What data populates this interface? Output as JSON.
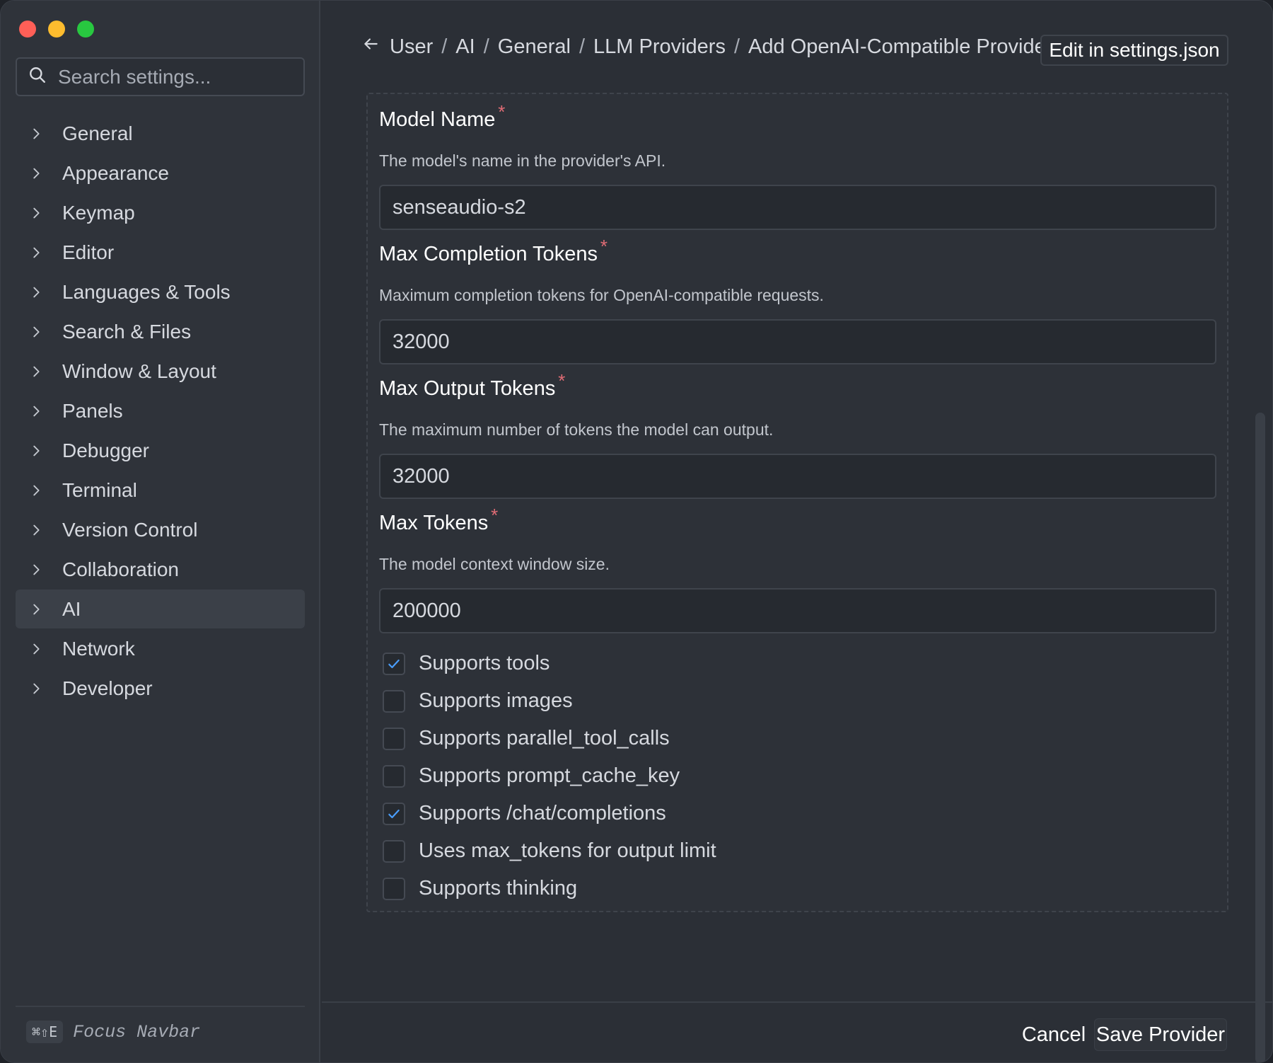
{
  "sidebar": {
    "search_placeholder": "Search settings...",
    "items": [
      {
        "label": "General",
        "active": false
      },
      {
        "label": "Appearance",
        "active": false
      },
      {
        "label": "Keymap",
        "active": false
      },
      {
        "label": "Editor",
        "active": false
      },
      {
        "label": "Languages & Tools",
        "active": false
      },
      {
        "label": "Search & Files",
        "active": false
      },
      {
        "label": "Window & Layout",
        "active": false
      },
      {
        "label": "Panels",
        "active": false
      },
      {
        "label": "Debugger",
        "active": false
      },
      {
        "label": "Terminal",
        "active": false
      },
      {
        "label": "Version Control",
        "active": false
      },
      {
        "label": "Collaboration",
        "active": false
      },
      {
        "label": "AI",
        "active": true
      },
      {
        "label": "Network",
        "active": false
      },
      {
        "label": "Developer",
        "active": false
      }
    ],
    "shortcut": "⌘⇧E",
    "shortcut_label": "Focus Navbar"
  },
  "header": {
    "breadcrumb": [
      "User",
      "AI",
      "General",
      "LLM Providers",
      "Add OpenAI-Compatible Provider"
    ],
    "separator": "/",
    "edit_json_label": "Edit in settings.json"
  },
  "form": {
    "fields": [
      {
        "label": "Model Name",
        "required_mark": "*",
        "description": "The model's name in the provider's API.",
        "value": "senseaudio-s2"
      },
      {
        "label": "Max Completion Tokens",
        "required_mark": "*",
        "description": "Maximum completion tokens for OpenAI-compatible requests.",
        "value": "32000"
      },
      {
        "label": "Max Output Tokens",
        "required_mark": "*",
        "description": "The maximum number of tokens the model can output.",
        "value": "32000"
      },
      {
        "label": "Max Tokens",
        "required_mark": "*",
        "description": "The model context window size.",
        "value": "200000"
      }
    ],
    "checkboxes": [
      {
        "label": "Supports tools",
        "checked": true
      },
      {
        "label": "Supports images",
        "checked": false
      },
      {
        "label": "Supports parallel_tool_calls",
        "checked": false
      },
      {
        "label": "Supports prompt_cache_key",
        "checked": false
      },
      {
        "label": "Supports /chat/completions",
        "checked": true
      },
      {
        "label": "Uses max_tokens for output limit",
        "checked": false
      },
      {
        "label": "Supports thinking",
        "checked": false
      }
    ]
  },
  "footer": {
    "cancel_label": "Cancel",
    "save_label": "Save Provider"
  },
  "colors": {
    "accent": "#4a9eff",
    "required": "#e06c75"
  }
}
